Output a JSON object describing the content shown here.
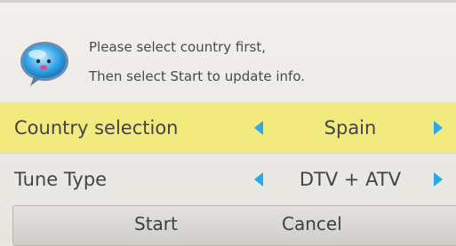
{
  "message": {
    "line1": "Please select country first,",
    "line2": "Then select Start to update info.",
    "mascot_icon": "smiley-bubble-icon"
  },
  "rows": [
    {
      "label": "Country selection",
      "value": "Spain",
      "selected": true
    },
    {
      "label": "Tune Type",
      "value": "DTV + ATV",
      "selected": false
    }
  ],
  "buttons": {
    "start_label": "Start",
    "cancel_label": "Cancel"
  },
  "colors": {
    "highlight": "#f2ea7e",
    "arrow": "#29a9e8",
    "background": "#efede8"
  }
}
